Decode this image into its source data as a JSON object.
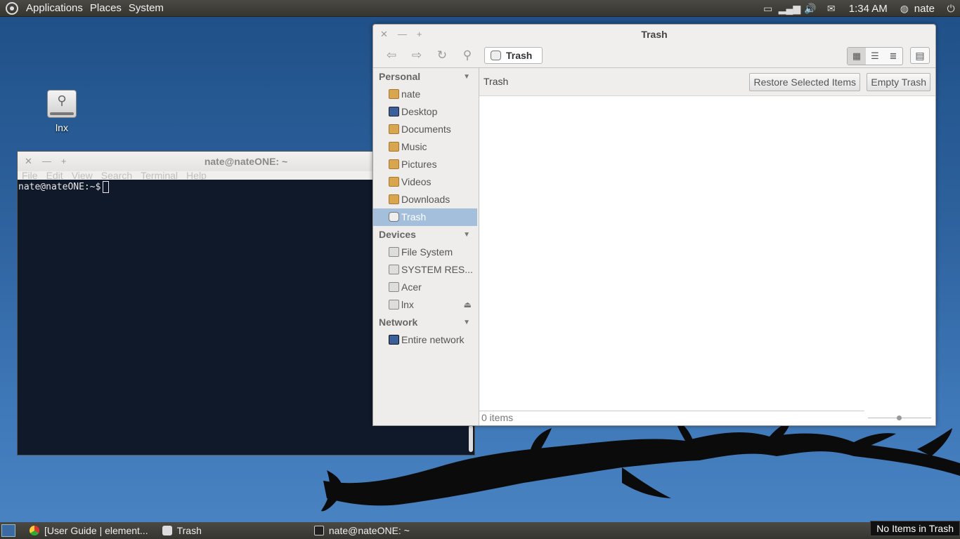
{
  "top_panel": {
    "menus": [
      "Applications",
      "Places",
      "System"
    ],
    "clock": "1:34 AM",
    "user": "nate"
  },
  "desktop": {
    "icons": [
      {
        "label": "lnx"
      }
    ]
  },
  "terminal": {
    "title": "nate@nateONE: ~",
    "menus": [
      "File",
      "Edit",
      "View",
      "Search",
      "Terminal",
      "Help"
    ],
    "prompt": "nate@nateONE:~$"
  },
  "file_manager": {
    "title": "Trash",
    "breadcrumb": "Trash",
    "sidebar": {
      "personal_heading": "Personal",
      "personal_items": [
        "nate",
        "Desktop",
        "Documents",
        "Music",
        "Pictures",
        "Videos",
        "Downloads",
        "Trash"
      ],
      "devices_heading": "Devices",
      "devices_items": [
        "File System",
        "SYSTEM RES...",
        "Acer",
        "lnx"
      ],
      "network_heading": "Network",
      "network_items": [
        "Entire network"
      ]
    },
    "infobar": {
      "label": "Trash",
      "restore_button": "Restore Selected Items",
      "empty_button": "Empty Trash"
    },
    "status": "0 items"
  },
  "bottom_panel": {
    "tasks": [
      "[User Guide | element...",
      "Trash",
      "nate@nateONE: ~"
    ],
    "tooltip": "No Items in Trash"
  }
}
